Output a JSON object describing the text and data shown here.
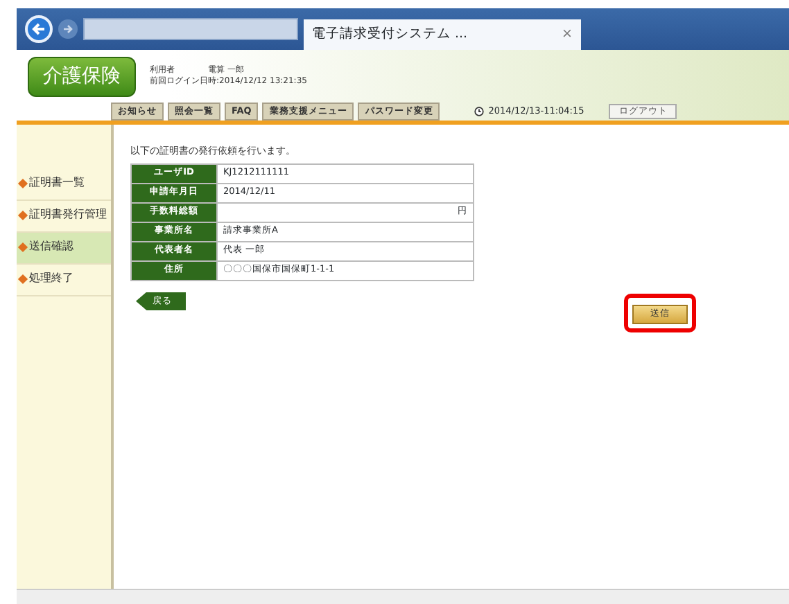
{
  "browser": {
    "tab_title": "電子請求受付システム ...",
    "tab_close": "×"
  },
  "header": {
    "logo": "介護保険",
    "user_line": "利用者　　　　電算 一郎",
    "login_line": "前回ログイン日時:2014/12/12 13:21:35",
    "clock": "2014/12/13-11:04:15",
    "logout": "ログアウト"
  },
  "nav": [
    {
      "label": "お知らせ"
    },
    {
      "label": "照会一覧"
    },
    {
      "label": "FAQ"
    },
    {
      "label": "業務支援メニュー"
    },
    {
      "label": "パスワード変更"
    }
  ],
  "sidebar": [
    {
      "label": "証明書一覧",
      "selected": false
    },
    {
      "label": "証明書発行管理",
      "selected": false
    },
    {
      "label": "送信確認",
      "selected": true
    },
    {
      "label": "処理終了",
      "selected": false
    }
  ],
  "intro": "以下の証明書の発行依頼を行います。",
  "table": {
    "rows": [
      {
        "label": "ユーザID",
        "value": "KJ1212111111"
      },
      {
        "label": "申請年月日",
        "value": "2014/12/11"
      },
      {
        "label": "手数料総額",
        "value": "",
        "unit": "円"
      },
      {
        "label": "事業所名",
        "value": "請求事業所A"
      },
      {
        "label": "代表者名",
        "value": "代表 一郎"
      },
      {
        "label": "住所",
        "value": "〇〇〇国保市国保町1-1-1"
      }
    ]
  },
  "back_button": "戻る",
  "send_button": {
    "label": "送信",
    "highlighted": true
  }
}
